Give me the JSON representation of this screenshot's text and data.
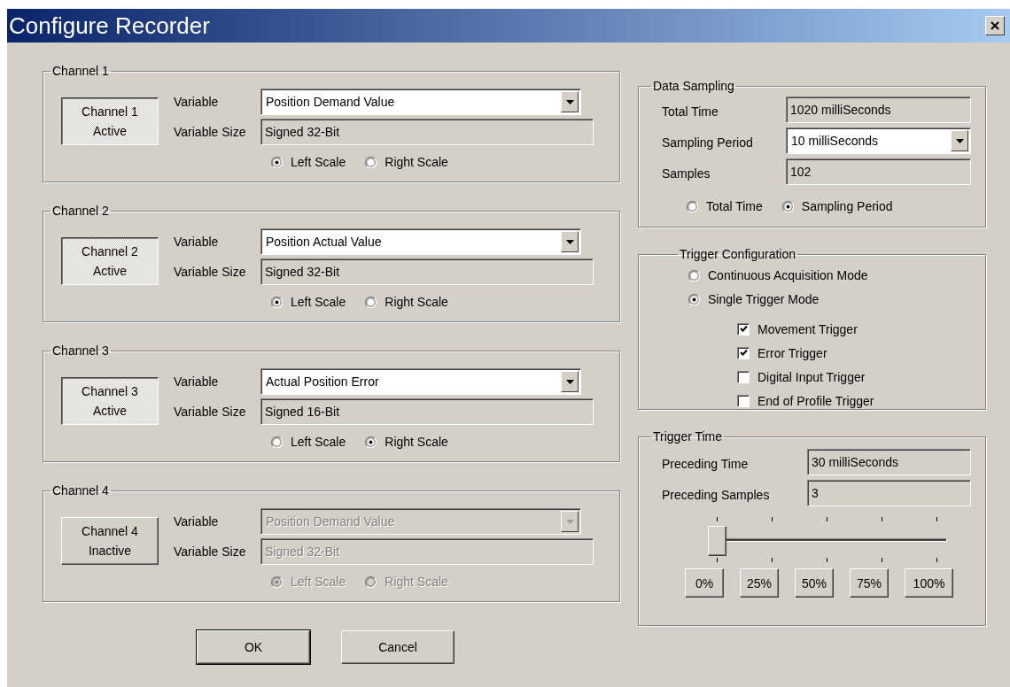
{
  "window": {
    "title": "Configure Recorder"
  },
  "channels": [
    {
      "title": "Channel 1",
      "button_lines": [
        "Channel 1",
        "Active"
      ],
      "active": true,
      "enabled": true,
      "variable_label": "Variable",
      "variable": "Position Demand Value",
      "size_label": "Variable Size",
      "size": "Signed 32-Bit",
      "scales": [
        {
          "label": "Left Scale",
          "selected": true
        },
        {
          "label": "Right Scale",
          "selected": false
        }
      ]
    },
    {
      "title": "Channel 2",
      "button_lines": [
        "Channel 2",
        "Active"
      ],
      "active": true,
      "enabled": true,
      "variable_label": "Variable",
      "variable": "Position Actual Value",
      "size_label": "Variable Size",
      "size": "Signed 32-Bit",
      "scales": [
        {
          "label": "Left Scale",
          "selected": true
        },
        {
          "label": "Right Scale",
          "selected": false
        }
      ]
    },
    {
      "title": "Channel 3",
      "button_lines": [
        "Channel 3",
        "Active"
      ],
      "active": true,
      "enabled": true,
      "variable_label": "Variable",
      "variable": "Actual Position Error",
      "size_label": "Variable Size",
      "size": "Signed 16-Bit",
      "scales": [
        {
          "label": "Left Scale",
          "selected": false
        },
        {
          "label": "Right Scale",
          "selected": true
        }
      ]
    },
    {
      "title": "Channel 4",
      "button_lines": [
        "Channel 4",
        "Inactive"
      ],
      "active": false,
      "enabled": false,
      "variable_label": "Variable",
      "variable": "Position Demand Value",
      "size_label": "Variable Size",
      "size": "Signed 32-Bit",
      "scales": [
        {
          "label": "Left Scale",
          "selected": true
        },
        {
          "label": "Right Scale",
          "selected": false
        }
      ]
    }
  ],
  "buttons": [
    {
      "label": "OK",
      "default": true
    },
    {
      "label": "Cancel",
      "default": false
    }
  ],
  "data_sampling": {
    "title": "Data Sampling",
    "fields": [
      {
        "kind": "readonly",
        "label": "Total Time",
        "value": "1020 milliSeconds"
      },
      {
        "kind": "dropdown",
        "label": "Sampling Period",
        "value": "10 milliSeconds"
      },
      {
        "kind": "readonly",
        "label": "Samples",
        "value": "102"
      }
    ],
    "modes": [
      {
        "label": "Total Time",
        "selected": false
      },
      {
        "label": "Sampling Period",
        "selected": true
      }
    ]
  },
  "trigger_configuration": {
    "title": "Trigger Configuration",
    "modes": [
      {
        "label": "Continuous Acquisition Mode",
        "selected": false
      },
      {
        "label": "Single Trigger Mode",
        "selected": true
      }
    ],
    "triggers": [
      {
        "label": "Movement Trigger",
        "checked": true
      },
      {
        "label": "Error Trigger",
        "checked": true
      },
      {
        "label": "Digital Input Trigger",
        "checked": false
      },
      {
        "label": "End of Profile Trigger",
        "checked": false
      }
    ]
  },
  "trigger_time": {
    "title": "Trigger Time",
    "fields": [
      {
        "kind": "readonly",
        "label": "Preceding Time",
        "value": "30 milliSeconds"
      },
      {
        "kind": "readonly",
        "label": "Preceding Samples",
        "value": "3"
      }
    ],
    "slider": {
      "level": 0
    },
    "presets": [
      "0%",
      "25%",
      "50%",
      "75%",
      "100%"
    ]
  }
}
